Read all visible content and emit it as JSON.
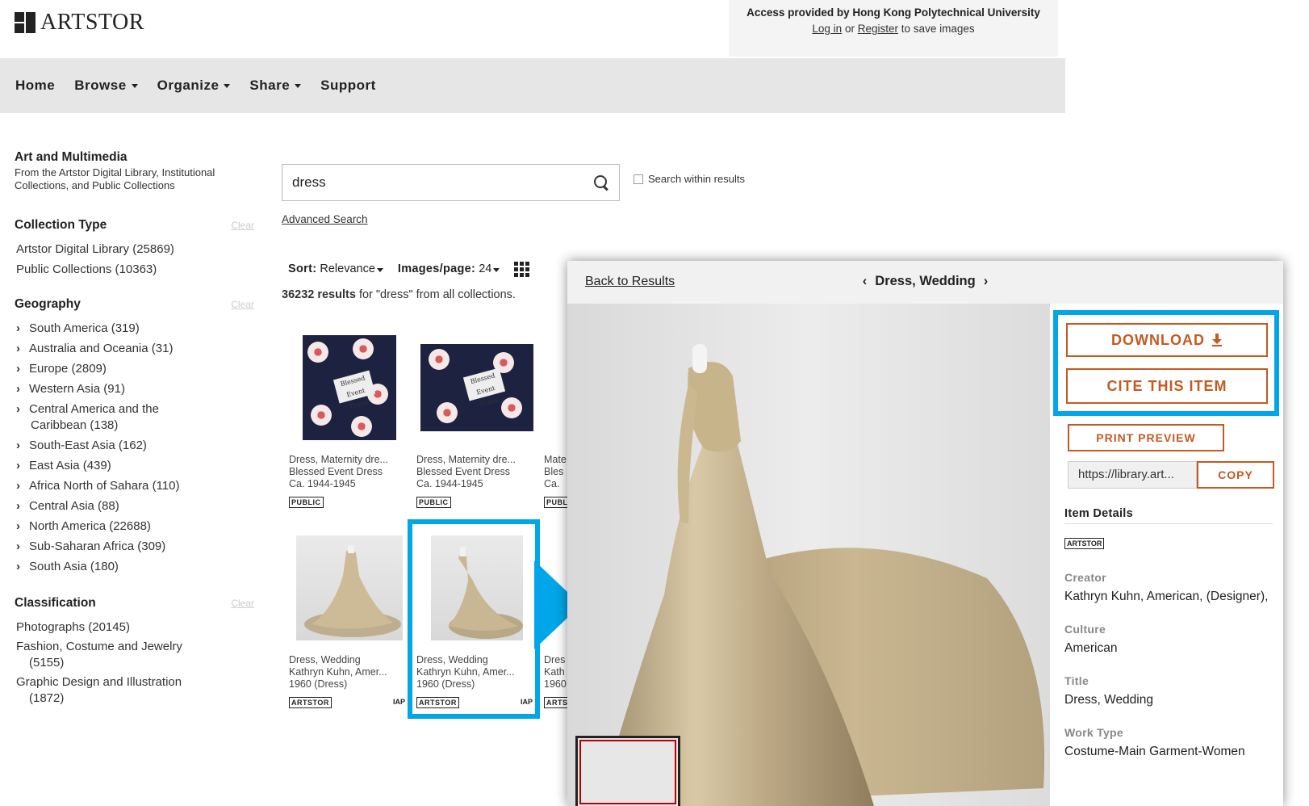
{
  "header": {
    "logo_text": "ARTSTOR",
    "access_text": "Access provided by Hong Kong Polytechnical University",
    "login_label": "Log in",
    "or_text": "or",
    "register_label": "Register",
    "save_text": "to save images"
  },
  "nav": {
    "home": "Home",
    "browse": "Browse",
    "organize": "Organize",
    "share": "Share",
    "support": "Support"
  },
  "sidebar": {
    "title": "Art and Multimedia",
    "subtitle": "From the Artstor Digital Library, Institutional Collections, and Public Collections",
    "clear_label": "Clear",
    "collection_type": {
      "heading": "Collection Type",
      "items": [
        "Artstor Digital Library (25869)",
        "Public Collections (10363)"
      ]
    },
    "geography": {
      "heading": "Geography",
      "items": [
        "South America (319)",
        "Australia and Oceania (31)",
        "Europe (2809)",
        "Western Asia (91)",
        "Central America and the",
        "Caribbean (138)",
        "South-East Asia (162)",
        "East Asia (439)",
        "Africa North of Sahara (110)",
        "Central Asia (88)",
        "North America (22688)",
        "Sub-Saharan Africa (309)",
        "South Asia (180)"
      ]
    },
    "classification": {
      "heading": "Classification",
      "items": [
        "Photographs (20145)",
        "Fashion, Costume and Jewelry",
        "(5155)",
        "Graphic Design and Illustration",
        "(1872)"
      ]
    }
  },
  "search": {
    "value": "dress",
    "within_label": "Search within results",
    "advanced_label": "Advanced Search"
  },
  "sort": {
    "sort_label": "Sort:",
    "sort_value": "Relevance",
    "per_page_label": "Images/page:",
    "per_page_value": "24",
    "count": "36232 results",
    "count_rest": "for \"dress\" from all collections."
  },
  "thumbs": [
    {
      "line1": "Dress, Maternity dre...",
      "line2": "Blessed Event Dress",
      "line3": "Ca. 1944-1945",
      "badge": "PUBLIC"
    },
    {
      "line1": "Dress, Maternity dre...",
      "line2": "Blessed Event Dress",
      "line3": "Ca. 1944-1945",
      "badge": "PUBLIC"
    },
    {
      "line1": "Mate",
      "line2": "Bles",
      "line3": "Ca.",
      "badge": "PUBL"
    },
    {
      "line1": "Dress, Wedding",
      "line2": "Kathryn Kuhn, Amer...",
      "line3": "1960 (Dress)",
      "badge": "ARTSTOR",
      "tag": "IAP"
    },
    {
      "line1": "Dress, Wedding",
      "line2": "Kathryn Kuhn, Amer...",
      "line3": "1960 (Dress)",
      "badge": "ARTSTOR",
      "tag": "IAP"
    },
    {
      "line1": "Dres",
      "line2": "Kath",
      "line3": "1960",
      "badge": "ARTS"
    }
  ],
  "label_patch_text": "Blessed Event Dress",
  "panel": {
    "back_label": "Back to Results",
    "title": "Dress, Wedding",
    "download_label": "DOWNLOAD",
    "cite_label": "CITE THIS ITEM",
    "print_label": "PRINT PREVIEW",
    "url_value": "https://library.art...",
    "copy_label": "COPY",
    "details_heading": "Item Details",
    "details_badge": "ARTSTOR",
    "fields": [
      {
        "label": "Creator",
        "value": "Kathryn Kuhn, American, (Designer),"
      },
      {
        "label": "Culture",
        "value": "American"
      },
      {
        "label": "Title",
        "value": "Dress, Wedding"
      },
      {
        "label": "Work Type",
        "value": "Costume-Main Garment-Women"
      }
    ]
  },
  "colors": {
    "accent_orange": "#c35a21",
    "highlight_blue": "#00a6e8",
    "nav_bg": "#e6e6e6"
  }
}
